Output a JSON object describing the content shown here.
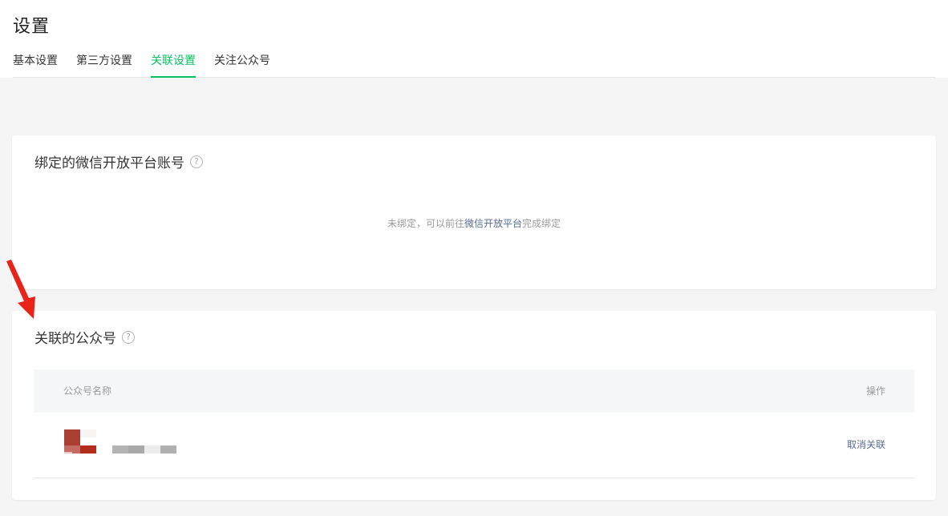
{
  "page": {
    "title": "设置"
  },
  "tabs": [
    {
      "label": "基本设置",
      "active": false
    },
    {
      "label": "第三方设置",
      "active": false
    },
    {
      "label": "关联设置",
      "active": true
    },
    {
      "label": "关注公众号",
      "active": false
    }
  ],
  "open_platform": {
    "title": "绑定的微信开放平台账号",
    "help_icon": "?",
    "empty_prefix": "未绑定，可以前往",
    "empty_link": "微信开放平台",
    "empty_suffix": "完成绑定"
  },
  "linked_accounts": {
    "title": "关联的公众号",
    "help_icon": "?",
    "columns": {
      "name": "公众号名称",
      "action": "操作"
    },
    "rows": [
      {
        "action_label": "取消关联"
      }
    ]
  },
  "colors": {
    "accent": "#07c160",
    "link": "#576b95",
    "annotation_arrow": "#e8231a"
  }
}
